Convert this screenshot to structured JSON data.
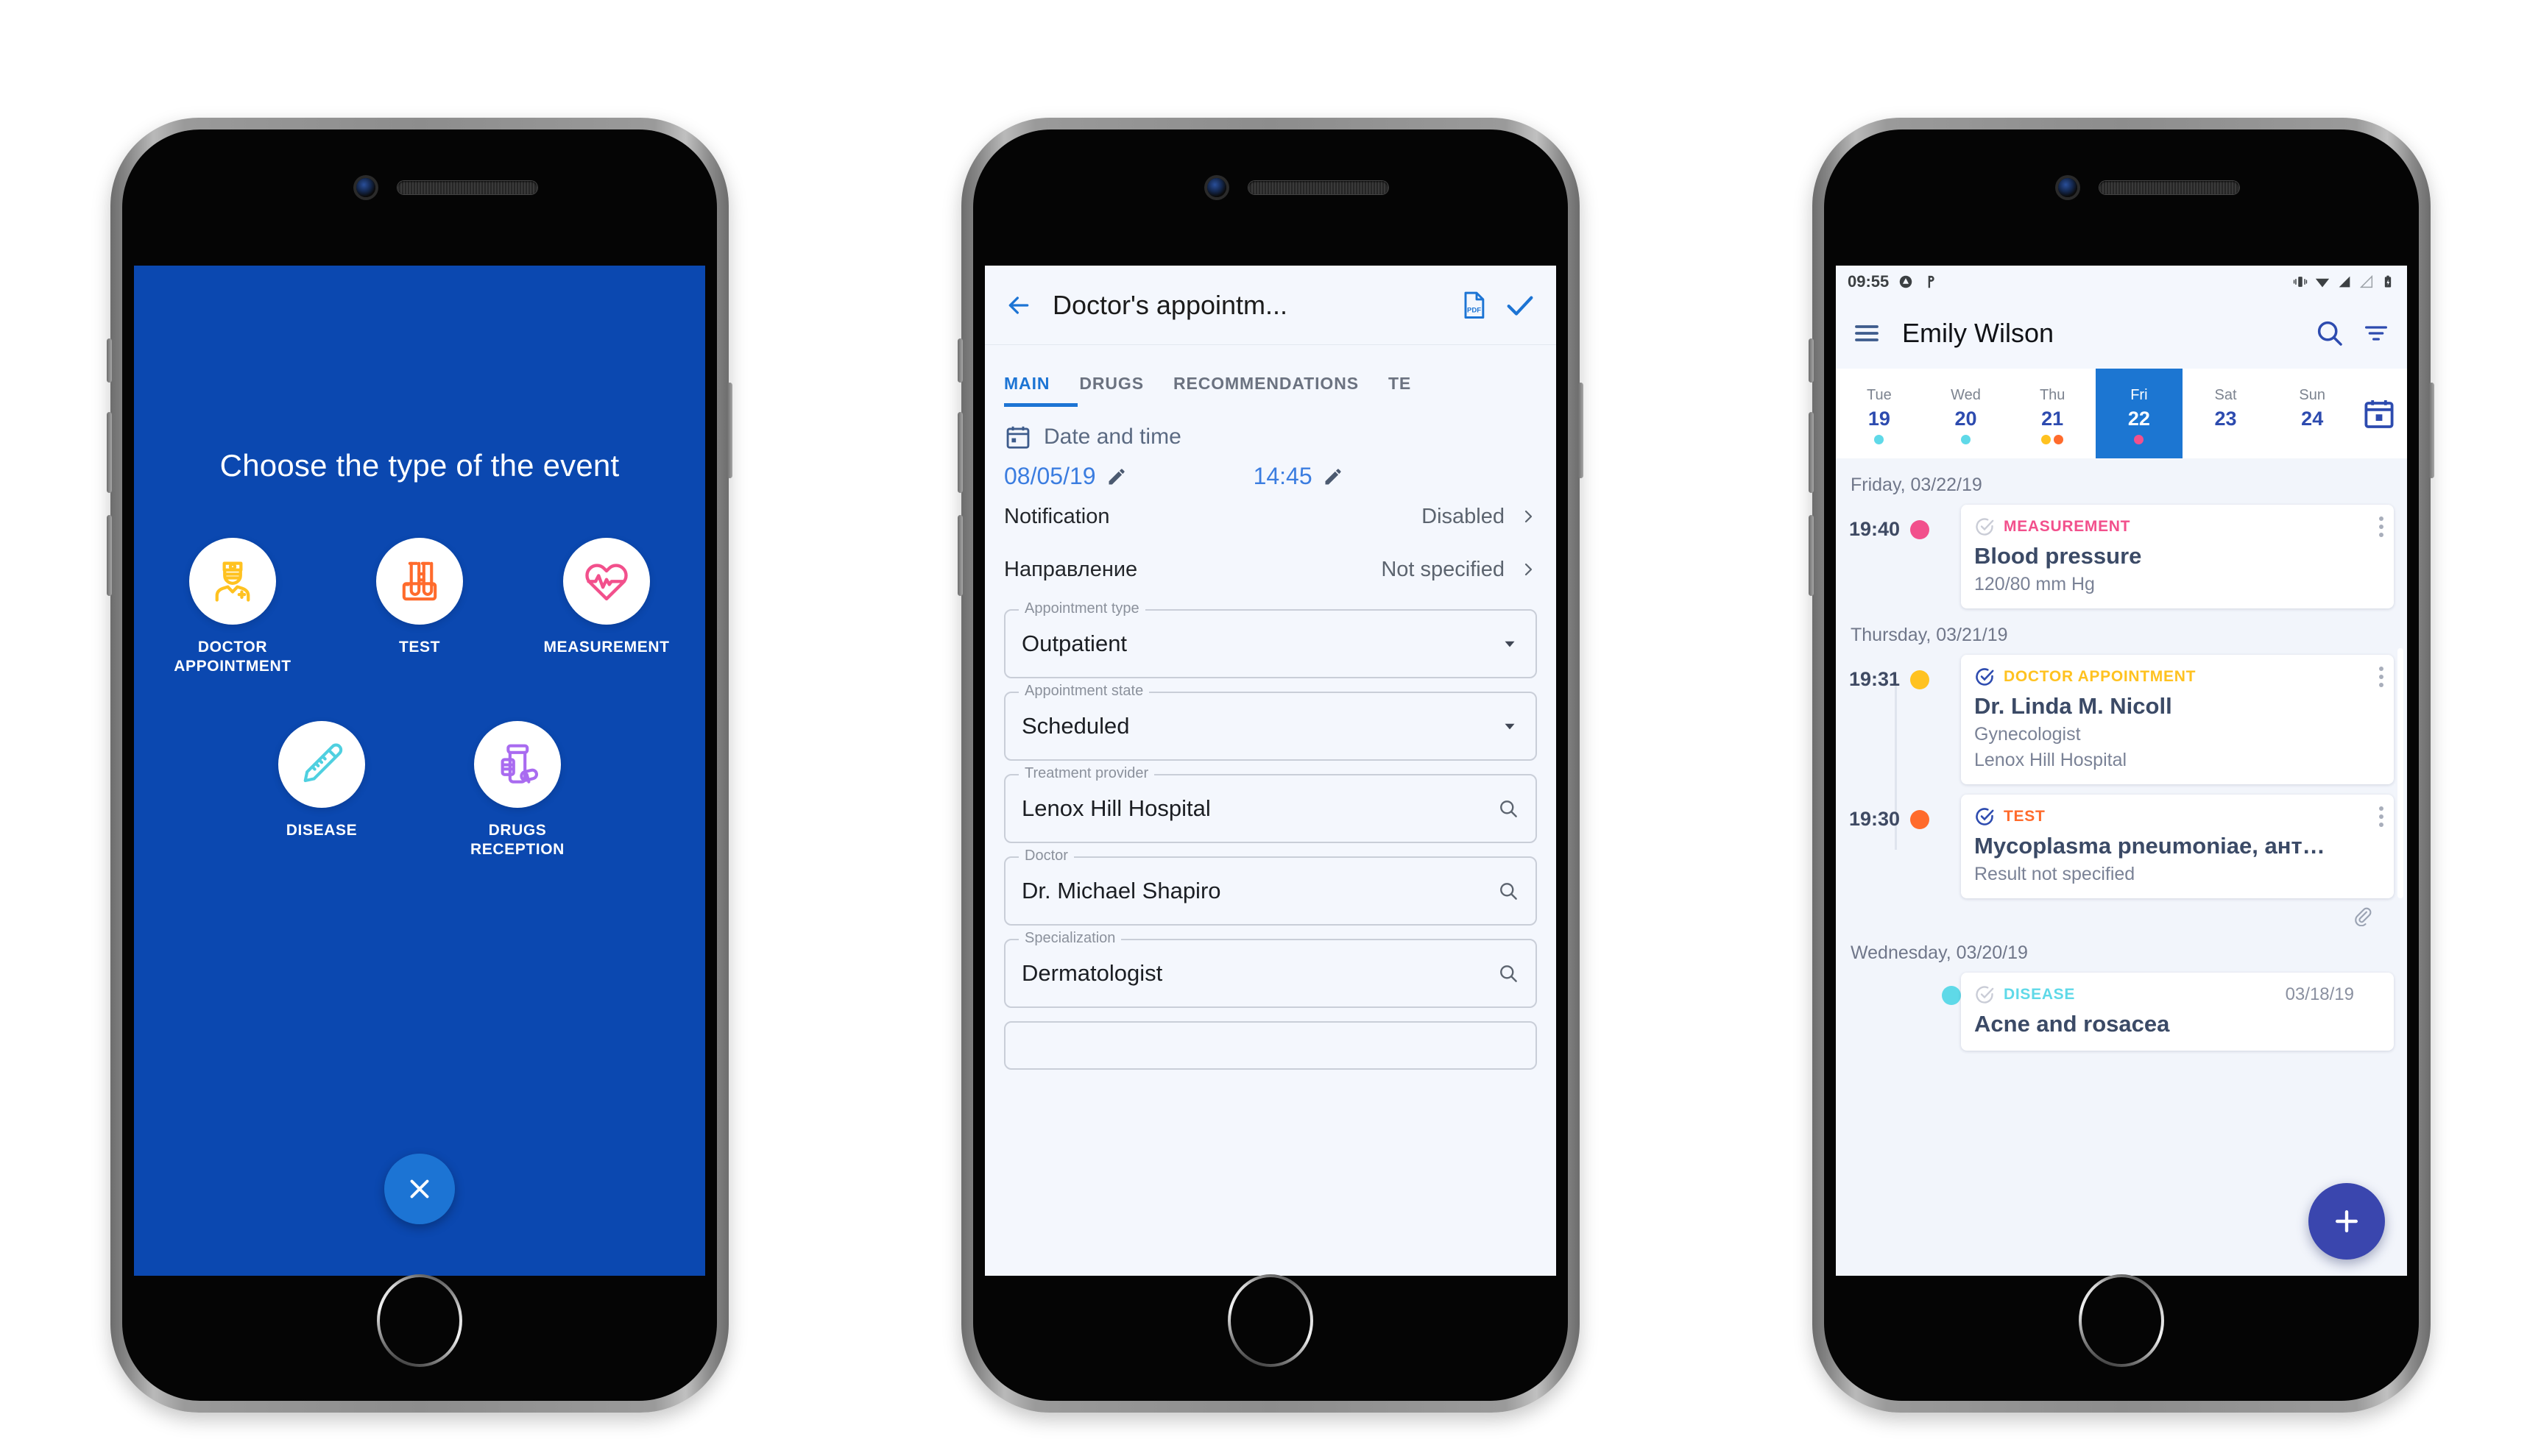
{
  "phone1": {
    "title": "Choose the type of the event",
    "options": [
      {
        "label": "DOCTOR\nAPPOINTMENT",
        "icon": "doctor-icon",
        "color": "#FFC220"
      },
      {
        "label": "TEST",
        "icon": "test-tubes-icon",
        "color": "#FF6B2C"
      },
      {
        "label": "MEASUREMENT",
        "icon": "heart-pulse-icon",
        "color": "#F2508C"
      },
      {
        "label": "DISEASE",
        "icon": "thermometer-icon",
        "color": "#4FD0E0"
      },
      {
        "label": "DRUGS\nRECEPTION",
        "icon": "pill-bottle-icon",
        "color": "#A96BF0"
      }
    ],
    "close_label": "×",
    "bg_color": "#0B48B0",
    "close_button_color": "#1C74D4"
  },
  "phone2": {
    "appbar": {
      "back_icon": "arrow-back-icon",
      "title": "Doctor's appointm...",
      "pdf_icon": "pdf-icon",
      "pdf_label": "PDF",
      "confirm_icon": "check-icon"
    },
    "tabs": [
      {
        "label": "MAIN",
        "active": true
      },
      {
        "label": "DRUGS",
        "active": false
      },
      {
        "label": "RECOMMENDATIONS",
        "active": false
      },
      {
        "label": "TE",
        "active": false
      }
    ],
    "datetime": {
      "section_label": "Date and time",
      "date": "08/05/19",
      "time": "14:45",
      "edit_icon": "pencil-icon",
      "calendar_icon": "calendar-icon"
    },
    "rows": [
      {
        "label": "Notification",
        "value": "Disabled"
      },
      {
        "label": "Направление",
        "value": "Not specified"
      }
    ],
    "fields": [
      {
        "label": "Appointment type",
        "value": "Outpatient",
        "control": "dropdown"
      },
      {
        "label": "Appointment state",
        "value": "Scheduled",
        "control": "dropdown"
      },
      {
        "label": "Treatment provider",
        "value": "Lenox Hill Hospital",
        "control": "search"
      },
      {
        "label": "Doctor",
        "value": "Dr. Michael Shapiro",
        "control": "search"
      },
      {
        "label": "Specialization",
        "value": "Dermatologist",
        "control": "search"
      },
      {
        "label": "",
        "value": "",
        "control": "none"
      }
    ],
    "accent_color": "#1C74D4"
  },
  "phone3": {
    "status_bar": {
      "time": "09:55",
      "icons_left": [
        "drive-icon",
        "parking-icon"
      ],
      "icons_right": [
        "vibrate-icon",
        "wifi-icon",
        "signal-icon",
        "signal-alt-icon",
        "battery-icon"
      ]
    },
    "appbar": {
      "menu_icon": "hamburger-menu-icon",
      "title": "Emily Wilson",
      "search_icon": "search-icon",
      "filter_icon": "filter-icon"
    },
    "calendar": {
      "days": [
        {
          "dow": "Tue",
          "num": "19",
          "selected": false,
          "dots": [
            "#5FD9E8"
          ]
        },
        {
          "dow": "Wed",
          "num": "20",
          "selected": false,
          "dots": [
            "#5FD9E8"
          ]
        },
        {
          "dow": "Thu",
          "num": "21",
          "selected": false,
          "dots": [
            "#FFC220",
            "#FF6B2C"
          ]
        },
        {
          "dow": "Fri",
          "num": "22",
          "selected": true,
          "dots": [
            "#F2508C"
          ]
        },
        {
          "dow": "Sat",
          "num": "23",
          "selected": false,
          "dots": []
        },
        {
          "dow": "Sun",
          "num": "24",
          "selected": false,
          "dots": []
        }
      ],
      "picker_icon": "calendar-picker-icon",
      "selected_color": "#1C76D2"
    },
    "groups": [
      {
        "date_header": "Friday, 03/22/19",
        "items": [
          {
            "time": "19:40",
            "dot_color": "#F2508C",
            "kind": "MEASUREMENT",
            "kind_color": "#F2508C",
            "check_done": false,
            "title": "Blood pressure",
            "subtitle": "120/80 mm Hg",
            "extra": "",
            "date_badge": "",
            "has_attachment": false
          }
        ]
      },
      {
        "date_header": "Thursday, 03/21/19",
        "items": [
          {
            "time": "19:31",
            "dot_color": "#FFC220",
            "kind": "DOCTOR APPOINTMENT",
            "kind_color": "#FFC220",
            "check_done": true,
            "title": "Dr. Linda M. Nicoll",
            "subtitle": "Gynecologist",
            "extra": "Lenox Hill Hospital",
            "date_badge": "",
            "has_attachment": false
          },
          {
            "time": "19:30",
            "dot_color": "#FF6B2C",
            "kind": "TEST",
            "kind_color": "#FF6B2C",
            "check_done": true,
            "title": "Mycoplasma pneumoniae, ант…",
            "subtitle": "Result not specified",
            "extra": "",
            "date_badge": "",
            "has_attachment": true
          }
        ]
      },
      {
        "date_header": "Wednesday, 03/20/19",
        "items": [
          {
            "time": "",
            "dot_color": "#5FD9E8",
            "kind": "DISEASE",
            "kind_color": "#5FD9E8",
            "check_done": false,
            "title": "Acne and rosacea",
            "subtitle": "",
            "extra": "",
            "date_badge": "03/18/19",
            "has_attachment": false
          }
        ]
      }
    ],
    "fab": {
      "icon": "plus-icon",
      "color": "#3A46AE"
    },
    "attachment_icon": "paperclip-icon",
    "kebab_icon": "more-vertical-icon"
  }
}
